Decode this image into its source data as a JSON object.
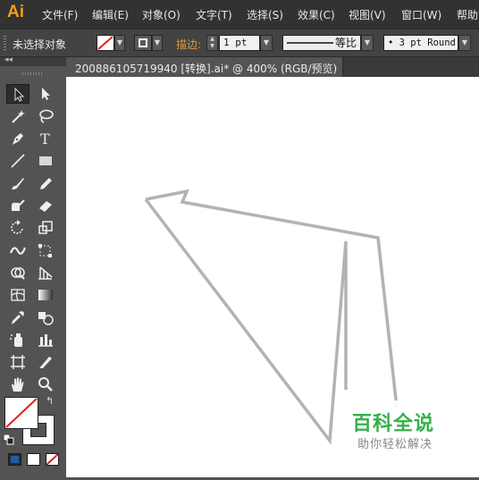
{
  "app": {
    "logo": "Ai"
  },
  "menu": [
    "文件(F)",
    "编辑(E)",
    "对象(O)",
    "文字(T)",
    "选择(S)",
    "效果(C)",
    "视图(V)",
    "窗口(W)",
    "帮助"
  ],
  "control_bar": {
    "selection_status": "未选择对象",
    "stroke_label": "描边:",
    "stroke_weight": "1 pt",
    "stroke_profile": "等比",
    "brush": "• 3 pt Round"
  },
  "document_tab": {
    "title": "200886105719940  [转换].ai* @ 400% (RGB/预览)"
  },
  "tools": [
    "selection",
    "direct-selection",
    "magic-wand",
    "lasso",
    "pen",
    "type",
    "line-segment",
    "rectangle",
    "paintbrush",
    "pencil",
    "blob-brush",
    "eraser",
    "rotate",
    "scale",
    "width",
    "free-transform",
    "shape-builder",
    "perspective-grid",
    "mesh",
    "gradient",
    "eyedropper",
    "blend",
    "symbol-sprayer",
    "column-graph",
    "artboard",
    "slice",
    "hand",
    "zoom"
  ],
  "colors": {
    "fill": "none",
    "stroke": "#ffffff",
    "canvas_path_stroke": "#b3b3b3",
    "menu_accent": "#f59b1e",
    "stroke_label_color": "#e39a3a"
  },
  "watermark": {
    "title": "百科全说",
    "subtitle": "助你轻松解决"
  }
}
